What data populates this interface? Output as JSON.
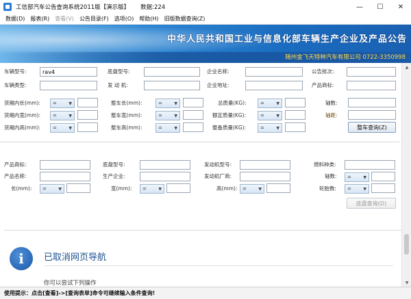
{
  "window": {
    "title": "工信部汽车公告查询系统2011版【演示版】",
    "count": "数据:224",
    "controls": [
      "—",
      "☐",
      "✕"
    ]
  },
  "menu": [
    {
      "label": "数据(D)",
      "enabled": true
    },
    {
      "label": "报表(R)",
      "enabled": true
    },
    {
      "label": "查看(V)",
      "enabled": false
    },
    {
      "label": "公告目录(F)",
      "enabled": true
    },
    {
      "label": "选项(O)",
      "enabled": true
    },
    {
      "label": "帮助(H)",
      "enabled": true
    },
    {
      "label": "旧版数据查询(Z)",
      "enabled": true
    }
  ],
  "banner": {
    "heading": "中华人民共和国工业与信息化部车辆生产企业及产品公告",
    "company": "随州金飞天特种汽车有限公司  0722-3350998"
  },
  "vehicle_form": {
    "vehicle_model_label": "车辆型号:",
    "vehicle_model_value": "rav4",
    "vehicle_type_label": "车辆类型:",
    "chassis_model_label": "底盘型号:",
    "engine_label": "发 动 机:",
    "company_name_label": "企业名称:",
    "company_address_label": "企业地址:",
    "announcement_batch_label": "公告批次:",
    "product_brand_label": "产品商标:",
    "cargo_length_label": "货厢内长(mm):",
    "cargo_width_label": "货厢内宽(mm):",
    "cargo_height_label": "货厢内高(mm):",
    "vehicle_length_label": "整车长(mm):",
    "vehicle_width_label": "整车宽(mm):",
    "vehicle_height_label": "整车高(mm):",
    "total_mass_label": "总质量(KG):",
    "rated_mass_label": "额定质量(KG):",
    "curb_mass_label": "整备质量(KG):",
    "axle_count_label": "轴数:",
    "wheelbase_label": "轴距:",
    "operator_default": "=",
    "search_button": "整车查询(Z)"
  },
  "chassis_form": {
    "product_brand_label": "产品商标:",
    "product_name_label": "产品名称:",
    "length_label": "长(mm):",
    "chassis_model_label": "底盘型号:",
    "manufacturer_label": "生产企业:",
    "width_label": "宽(mm):",
    "engine_model_label": "发动机型号:",
    "engine_maker_label": "发动机厂商:",
    "height_label": "高(mm):",
    "fuel_type_label": "燃料种类:",
    "axle_count_label": "轴数:",
    "tire_count_label": "轮胎数:",
    "operator_default": "=",
    "search_button": "底盘查询(D)"
  },
  "result_pane": {
    "message": "已取消网页导航",
    "partial_line": "你可以尝试下列操作"
  },
  "status": {
    "text": "使用提示：点击[查看]->[查询表单]命令可继续输入条件查询!"
  }
}
